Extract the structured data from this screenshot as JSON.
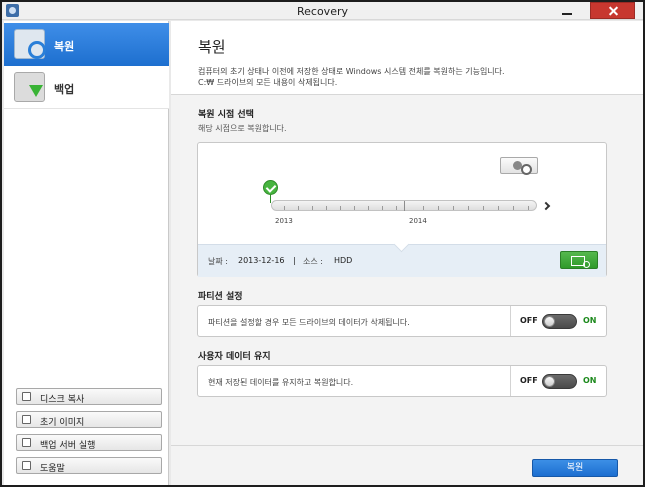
{
  "window": {
    "title": "Recovery"
  },
  "sidebar": {
    "nav": [
      {
        "label": "복원",
        "icon": "restore-drive-icon",
        "selected": true
      },
      {
        "label": "백업",
        "icon": "backup-download-icon",
        "selected": false
      }
    ],
    "buttons": [
      {
        "label": "디스크 복사",
        "icon": "disk-copy-icon"
      },
      {
        "label": "초기 이미지",
        "icon": "initial-image-icon"
      },
      {
        "label": "백업 서버 실행",
        "icon": "backup-server-icon"
      },
      {
        "label": "도움말",
        "icon": "help-icon"
      }
    ]
  },
  "main": {
    "title": "복원",
    "description_line1": "컴퓨터의 초기 상태나 이전에 저장한 상태로 Windows 시스템 전체를 복원하는 기능입니다.",
    "description_line2": "C:₩ 드라이브의 모든 내용이 삭제됩니다.",
    "restore_point": {
      "title": "복원 시점 선택",
      "subtitle": "해당 시점으로 복원합니다.",
      "years": [
        "2013",
        "2014"
      ],
      "date_label": "날짜 :",
      "date": "2013-12-16",
      "separator": "|",
      "source_label": "소스 :",
      "source": "HDD"
    },
    "partition": {
      "title": "파티션 설정",
      "description": "파티션을 설정할 경우 모든 드라이브의 데이터가 삭제됩니다.",
      "off_label": "OFF",
      "on_label": "ON",
      "state": "off"
    },
    "user_data": {
      "title": "사용자 데이터 유지",
      "description": "현재 저장된 데이터를 유지하고 복원합니다.",
      "off_label": "OFF",
      "on_label": "ON",
      "state": "off"
    },
    "action_button": "복원"
  },
  "colors": {
    "accent": "#1d6fcf",
    "success": "#47b43f",
    "on_text": "#1d8a1d"
  }
}
